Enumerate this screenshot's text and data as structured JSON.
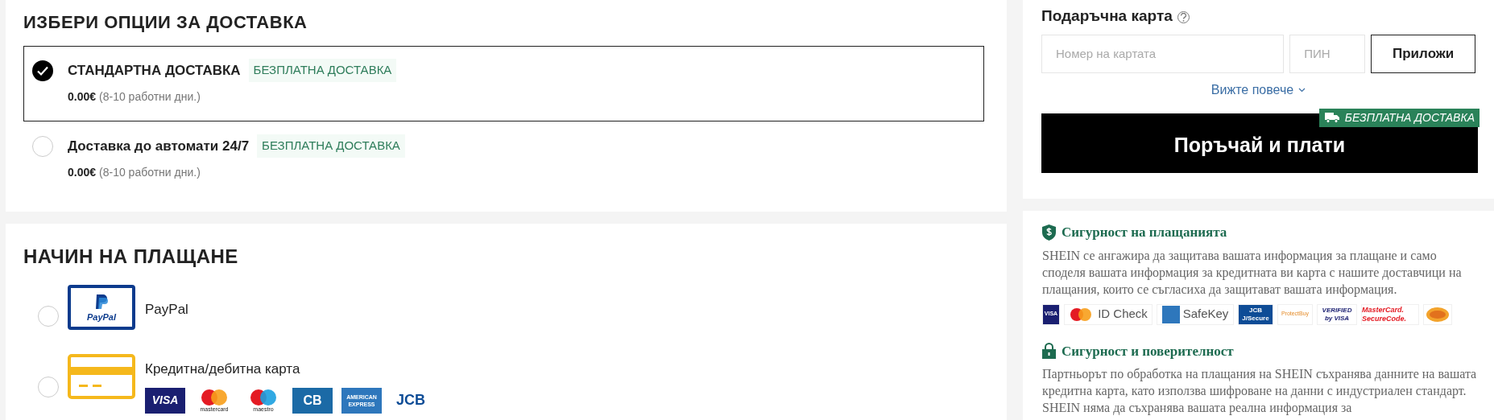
{
  "delivery": {
    "title": "ИЗБЕРИ ОПЦИИ ЗА ДОСТАВКА",
    "options": [
      {
        "name": "СТАНДАРТНА ДОСТАВКА",
        "badge": "БЕЗПЛАТНА ДОСТАВКА",
        "price": "0.00€",
        "duration": "(8-10 работни дни.)",
        "selected": true
      },
      {
        "name": "Доставка до автомати 24/7",
        "badge": "БЕЗПЛАТНА ДОСТАВКА",
        "price": "0.00€",
        "duration": "(8-10 работни дни.)",
        "selected": false
      }
    ]
  },
  "payment": {
    "title": "НАЧИН НА ПЛАЩАНЕ",
    "methods": [
      {
        "kind": "paypal",
        "logo_text": "PayPal",
        "label": "PayPal",
        "selected": false
      },
      {
        "kind": "card",
        "label": "Кредитна/дебитна карта",
        "selected": false,
        "logos": [
          {
            "kind": "visa",
            "text": "VISA"
          },
          {
            "kind": "mastercard",
            "text": "mastercard"
          },
          {
            "kind": "maestro",
            "text": "maestro"
          },
          {
            "kind": "cb",
            "text": "CB"
          },
          {
            "kind": "amex",
            "text": "AMERICAN EXPRESS"
          },
          {
            "kind": "jcb",
            "text": "JCB"
          }
        ]
      }
    ]
  },
  "gift_card": {
    "title": "Подаръчна карта",
    "number_placeholder": "Номер на картата",
    "pin_placeholder": "ПИН",
    "apply": "Приложи",
    "more": "Вижте повече"
  },
  "order": {
    "button": "Поръчай и плати",
    "badge": "БЕЗПЛАТНА ДОСТАВКА"
  },
  "security": [
    {
      "kind": "payment",
      "title": "Сигурност на плащанията",
      "text": "SHEIN се ангажира да защитава вашата информация за плащане и само споделя вашата информация за кредитната ви карта с нашите доставчици на плащания, които се съгласиха да защитават вашата информация.",
      "badges": [
        {
          "kind": "visa-secure",
          "text": "VISA"
        },
        {
          "kind": "id-check",
          "text": "ID Check"
        },
        {
          "kind": "safekey",
          "text": "SafeKey"
        },
        {
          "kind": "jcb-secure",
          "text": "JCB J/Secure"
        },
        {
          "kind": "protectbuy",
          "text": "ProtectBuy"
        },
        {
          "kind": "verified-visa",
          "text": "VERIFIED by VISA"
        },
        {
          "kind": "securecode",
          "text": "MasterCard. SecureCode."
        },
        {
          "kind": "seal"
        }
      ]
    },
    {
      "kind": "privacy",
      "title": "Сигурност и поверителност",
      "text": "Партньорът по обработка на плащания на SHEIN съхранява данните на вашата кредитна карта, като използва шифроване на данни с индустриален стандарт. SHEIN няма да съхранява вашата реална информация за"
    }
  ]
}
